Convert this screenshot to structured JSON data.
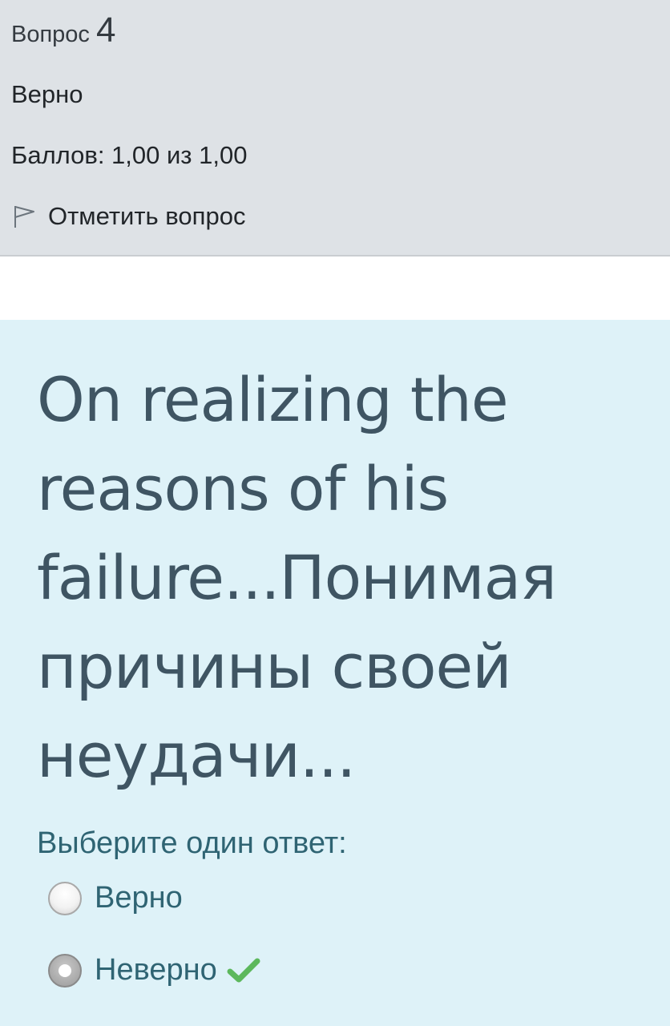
{
  "info": {
    "question_label": "Вопрос",
    "question_number": "4",
    "state": "Верно",
    "grade": "Баллов: 1,00 из 1,00",
    "flag_label": "Отметить вопрос",
    "flag_icon": "flag-outline-icon"
  },
  "question": {
    "text": "On realizing the reasons of his failure...Понимая причины своей неудачи...",
    "prompt": "Выберите один ответ:",
    "options": [
      {
        "label": "Верно",
        "selected": false
      },
      {
        "label": "Неверно",
        "selected": true,
        "mark": "correct-check-icon"
      }
    ]
  },
  "colors": {
    "info_bg": "#dee2e6",
    "formulation_bg": "#def2f8",
    "question_text": "#3f5563",
    "answer_text": "#2f6473",
    "correct_check": "#5cb85c"
  }
}
